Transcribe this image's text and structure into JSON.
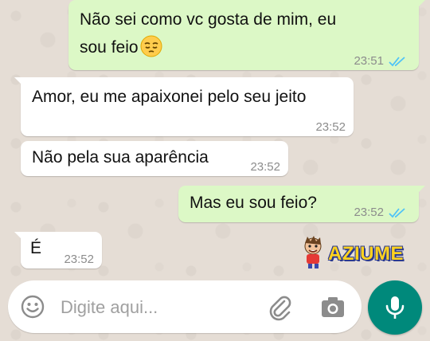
{
  "messages": [
    {
      "direction": "outgoing",
      "line1": "Não sei como vc gosta de mim, eu",
      "line2": "sou feio",
      "emoji": "pensive-face-emoji",
      "time": "23:51",
      "status": "read"
    },
    {
      "direction": "incoming",
      "text": "Amor, eu me apaixonei pelo seu jeito",
      "time": "23:52"
    },
    {
      "direction": "incoming",
      "text": "Não pela sua aparência",
      "time": "23:52"
    },
    {
      "direction": "outgoing",
      "text": "Mas eu sou feio?",
      "time": "23:52",
      "status": "read"
    },
    {
      "direction": "incoming",
      "text": "É",
      "time": "23:52"
    }
  ],
  "watermark": {
    "text": "AZIUME"
  },
  "composer": {
    "placeholder": "Digite aqui..."
  },
  "icons": {
    "emoji": "emoji-icon",
    "attach": "paperclip-icon",
    "camera": "camera-icon",
    "mic": "microphone-icon"
  },
  "colors": {
    "outgoing_bubble": "#dcf8c6",
    "incoming_bubble": "#ffffff",
    "background": "#e5ddd5",
    "send_button": "#00897b",
    "read_ticks": "#4fc3f7"
  }
}
